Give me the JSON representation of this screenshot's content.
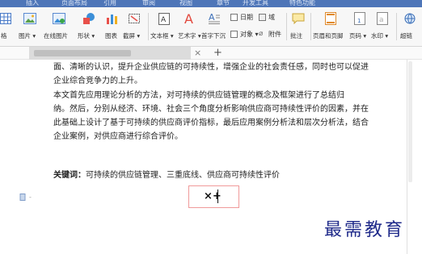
{
  "ribbon": {
    "menu_items": [
      "插入",
      "页面布局",
      "引用",
      "审阅",
      "视图",
      "章节",
      "开发工具",
      "特色功能"
    ],
    "tools": [
      {
        "label": "格",
        "icon": "table-icon"
      },
      {
        "label": "图片 ▾",
        "icon": "picture-icon"
      },
      {
        "label": "在线图片",
        "icon": "online-picture-icon"
      },
      {
        "label": "形状 ▾",
        "icon": "shapes-icon"
      },
      {
        "label": "图表",
        "icon": "chart-icon"
      },
      {
        "label": "截屏 ▾",
        "icon": "screenshot-icon"
      },
      {
        "label": "文本框 ▾",
        "icon": "textbox-icon"
      },
      {
        "label": "艺术字 ▾",
        "icon": "wordart-icon"
      },
      {
        "label": "首字下沉",
        "icon": "dropcap-icon"
      },
      {
        "label": "批注",
        "icon": "comment-icon"
      },
      {
        "label": "页眉和页脚",
        "icon": "header-footer-icon"
      },
      {
        "label": "页码 ▾",
        "icon": "page-number-icon"
      },
      {
        "label": "水印 ▾",
        "icon": "watermark-icon"
      },
      {
        "label": "超链",
        "icon": "hyperlink-icon"
      }
    ],
    "small_tools": {
      "date": "日期",
      "field": "域",
      "object": "对象 ▾",
      "attachment": "附件"
    }
  },
  "tabs": {
    "close": "×",
    "add": "+"
  },
  "document": {
    "lines": [
      "面、清晰的认识，提升企业供应链的可持续性，增强企业的社会责任感，同时也可以促进",
      "企业综合竞争力的上升。",
      "    本文首先应用理论分析的方法，对可持续的供应链管理的概念及框架进行了总结归",
      "纳。然后，分别从经济、环境、社会三个角度分析影响供应商可持续性评价的因素，并在",
      "此基础上设计了基于可持续的供应商评价指标，最后应用案例分析法和层次分析法，结合",
      "企业案例，对供应商进行综合评价。"
    ],
    "keywords_label": "关键词：",
    "keywords_text": "可持续的供应链管理、三重底线、供应商可持续性评价",
    "formula": "×+"
  },
  "watermark": "最需教育"
}
